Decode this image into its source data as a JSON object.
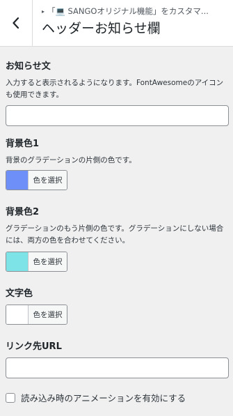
{
  "header": {
    "breadcrumb": "「💻 SANGOオリジナル機能」をカスタマ...",
    "breadcrumb_icon": "laptop-icon",
    "title": "ヘッダーお知らせ欄",
    "back_icon": "chevron-left-icon"
  },
  "fields": {
    "notice": {
      "label": "お知らせ文",
      "description": "入力すると表示されるようになります。FontAwesomeのアイコンも使用できます。",
      "value": ""
    },
    "bg1": {
      "label": "背景色1",
      "description": "背景のグラデーションの片側の色です。",
      "button_label": "色を選択",
      "color": "#6f8ff8"
    },
    "bg2": {
      "label": "背景色2",
      "description": "グラデーションのもう片側の色です。グラデーションにしない場合には、両方の色を合わせてください。",
      "button_label": "色を選択",
      "color": "#7de3e6"
    },
    "text_color": {
      "label": "文字色",
      "button_label": "色を選択",
      "color": "#ffffff"
    },
    "link_url": {
      "label": "リンク先URL",
      "value": ""
    },
    "animation": {
      "label": "読み込み時のアニメーションを有効にする",
      "checked": false
    }
  }
}
